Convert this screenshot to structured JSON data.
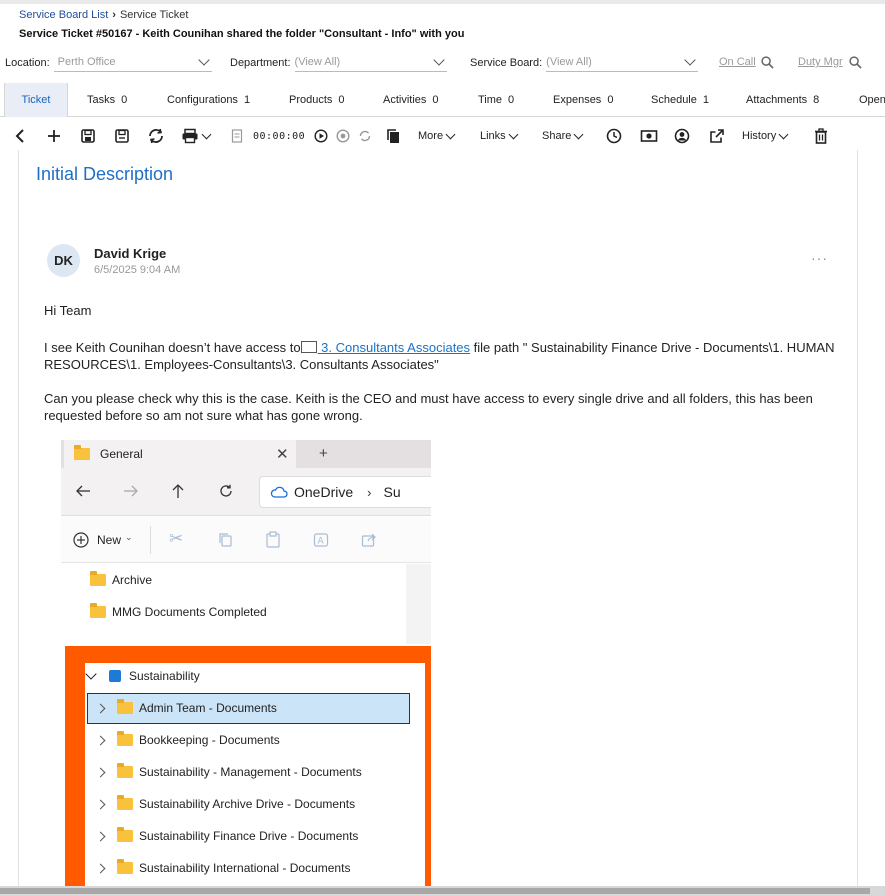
{
  "breadcrumb": {
    "parent": "Service Board List",
    "current": "Service Ticket"
  },
  "ticket_title": "Service Ticket #50167 - Keith Counihan shared the folder \"Consultant - Info\" with you",
  "filters": {
    "location": {
      "label": "Location:",
      "value": "Perth Office"
    },
    "department": {
      "label": "Department:",
      "value": "(View All)"
    },
    "service_board": {
      "label": "Service Board:",
      "value": "(View All)"
    },
    "on_call": "On Call",
    "duty_mgr": "Duty Mgr"
  },
  "tabs": [
    {
      "label": "Ticket",
      "count": ""
    },
    {
      "label": "Tasks",
      "count": "0"
    },
    {
      "label": "Configurations",
      "count": "1"
    },
    {
      "label": "Products",
      "count": "0"
    },
    {
      "label": "Activities",
      "count": "0"
    },
    {
      "label": "Time",
      "count": "0"
    },
    {
      "label": "Expenses",
      "count": "0"
    },
    {
      "label": "Schedule",
      "count": "1"
    },
    {
      "label": "Attachments",
      "count": "8"
    },
    {
      "label": "Open",
      "count": ""
    }
  ],
  "toolbar": {
    "timer": "00:00:00",
    "more": "More",
    "links": "Links",
    "share": "Share",
    "history": "History"
  },
  "section_title": "Initial Description",
  "note": {
    "initials": "DK",
    "author": "David Krige",
    "date": "6/5/2025 9:04 AM",
    "more": "···",
    "greeting": "Hi Team",
    "p1_before": "I see Keith Counihan doesn’t have access to",
    "p1_link": " 3. Consultants Associates",
    "p1_after": " file path \" Sustainability Finance Drive - Documents\\1. HUMAN RESOURCES\\1. Employees-Consultants\\3. Consultants Associates\"",
    "p2": "Can you please check why this is the case. Keith is the CEO and must have access to every single drive and all folders, this has been requested before so am not sure what has gone wrong."
  },
  "explorer": {
    "tab_title": "General",
    "address": "OneDrive",
    "address_next": "Su",
    "new_label": "New",
    "folders": [
      "Archive",
      "MMG Documents Completed"
    ],
    "tree_root": "Sustainability",
    "tree_items": [
      "Admin Team - Documents",
      "Bookkeeping - Documents",
      "Sustainability - Management - Documents",
      "Sustainability Archive Drive - Documents",
      "Sustainability Finance Drive - Documents",
      "Sustainability International - Documents"
    ],
    "highlight_color": "#ff5a00"
  }
}
